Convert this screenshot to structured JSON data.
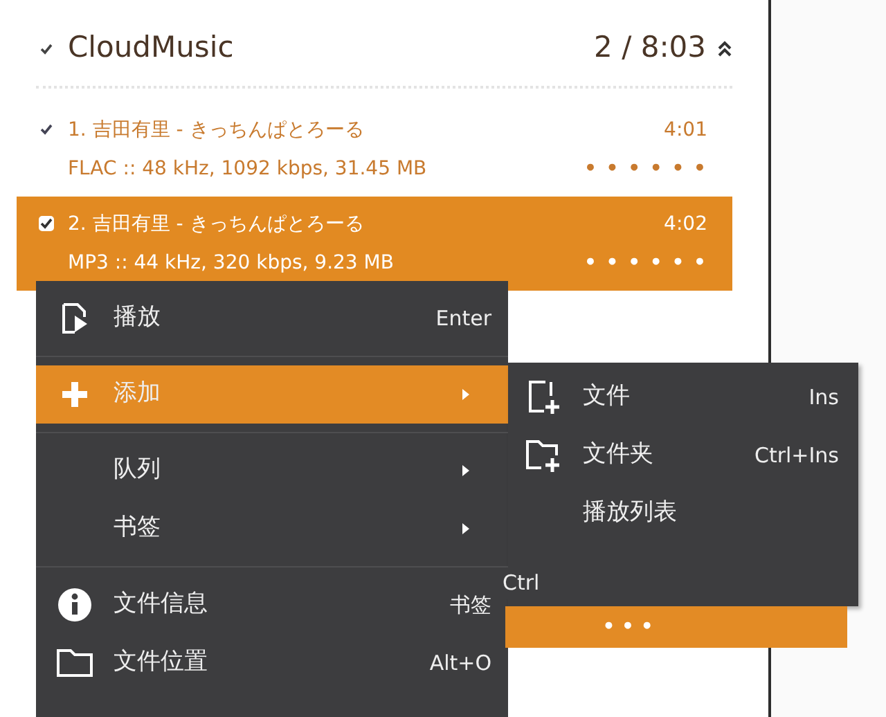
{
  "playlist": {
    "checked": true,
    "title": "CloudMusic",
    "summary": "2 / 8:03"
  },
  "tracks": [
    {
      "checked": true,
      "selected": false,
      "title": "1. 吉田有里 - きっちんぱとろーる",
      "duration": "4:01",
      "format": "FLAC :: 48 kHz, 1092 kbps, 31.45 MB",
      "rating": "•  •  •  •  •  •"
    },
    {
      "checked": true,
      "selected": true,
      "title": "2. 吉田有里 - きっちんぱとろーる",
      "duration": "4:02",
      "format": "MP3 :: 44 kHz, 320 kbps, 9.23 MB",
      "rating": "•  •  •  •  •  •"
    }
  ],
  "context_menu": {
    "items": [
      {
        "kind": "item",
        "label": "播放",
        "shortcut": "Enter",
        "selected": false,
        "submenu": false
      },
      {
        "kind": "separator"
      },
      {
        "kind": "item",
        "label": "添加",
        "selected": true,
        "submenu": true
      },
      {
        "kind": "separator"
      },
      {
        "kind": "item",
        "label": "队列",
        "selected": false,
        "submenu": true
      },
      {
        "kind": "item",
        "label": "书签",
        "selected": false,
        "submenu": true
      },
      {
        "kind": "separator"
      },
      {
        "kind": "item",
        "label": "文件信息",
        "shortcut": "书签",
        "selected": false,
        "submenu": false
      },
      {
        "kind": "item",
        "label": "文件位置",
        "shortcut": "Alt+O",
        "selected": false,
        "submenu": false
      }
    ]
  },
  "submenu": {
    "items": [
      {
        "label": "文件",
        "shortcut": "Ins"
      },
      {
        "label": "文件夹",
        "shortcut": "Ctrl+Ins"
      },
      {
        "label": "播放列表"
      }
    ]
  },
  "overlay": {
    "fragment": "Ctrl",
    "dots": "•  •  •"
  }
}
